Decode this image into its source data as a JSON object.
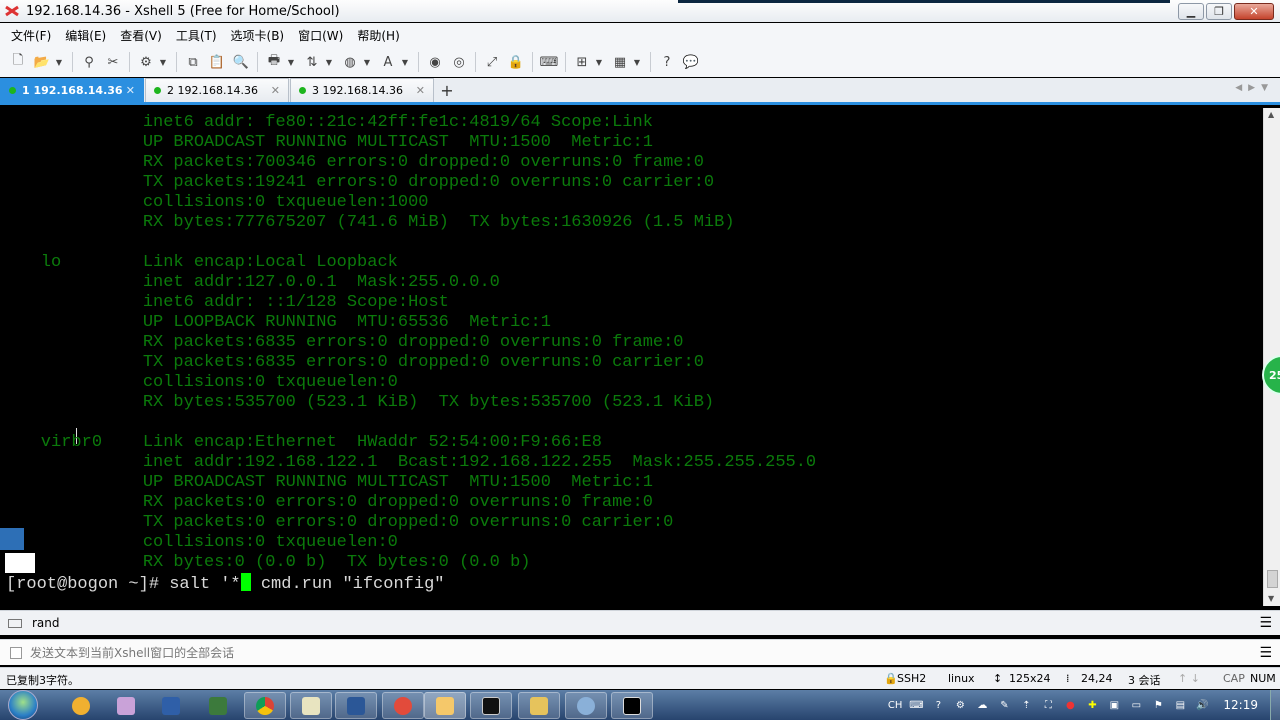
{
  "window": {
    "title": "192.168.14.36 - Xshell 5 (Free for Home/School)",
    "min_label": "▁",
    "max_label": "❐",
    "close_label": "✕"
  },
  "menu": [
    "文件(F)",
    "编辑(E)",
    "查看(V)",
    "工具(T)",
    "选项卡(B)",
    "窗口(W)",
    "帮助(H)"
  ],
  "toolbar_icons": [
    "new-session-icon",
    "open-folder-icon",
    "reconnect-icon",
    "disconnect-icon",
    "properties-icon",
    "copy-icon",
    "paste-icon",
    "find-icon",
    "print-icon",
    "transfer-icon",
    "globe-icon",
    "font-icon",
    "xftp-icon",
    "xmanager-icon",
    "fullscreen-icon",
    "lock-icon",
    "keyboard-icon",
    "add-tab-icon",
    "layout-icon",
    "help-icon",
    "chat-icon"
  ],
  "tabs": [
    {
      "number": "1",
      "label": "192.168.14.36",
      "active": true
    },
    {
      "number": "2",
      "label": "192.168.14.36",
      "active": false
    },
    {
      "number": "3",
      "label": "192.168.14.36",
      "active": false
    }
  ],
  "tab_add_label": "+",
  "terminal": {
    "lines": [
      "              inet6 addr: fe80::21c:42ff:fe1c:4819/64 Scope:Link",
      "              UP BROADCAST RUNNING MULTICAST  MTU:1500  Metric:1",
      "              RX packets:700346 errors:0 dropped:0 overruns:0 frame:0",
      "              TX packets:19241 errors:0 dropped:0 overruns:0 carrier:0",
      "              collisions:0 txqueuelen:1000",
      "              RX bytes:777675207 (741.6 MiB)  TX bytes:1630926 (1.5 MiB)",
      "",
      "    lo        Link encap:Local Loopback",
      "              inet addr:127.0.0.1  Mask:255.0.0.0",
      "              inet6 addr: ::1/128 Scope:Host",
      "              UP LOOPBACK RUNNING  MTU:65536  Metric:1",
      "              RX packets:6835 errors:0 dropped:0 overruns:0 frame:0",
      "              TX packets:6835 errors:0 dropped:0 overruns:0 carrier:0",
      "              collisions:0 txqueuelen:0",
      "              RX bytes:535700 (523.1 KiB)  TX bytes:535700 (523.1 KiB)",
      "",
      "    virbr0    Link encap:Ethernet  HWaddr 52:54:00:F9:66:E8",
      "              inet addr:192.168.122.1  Bcast:192.168.122.255  Mask:255.255.255.0",
      "              UP BROADCAST RUNNING MULTICAST  MTU:1500  Metric:1",
      "              RX packets:0 errors:0 dropped:0 overruns:0 frame:0",
      "              TX packets:0 errors:0 dropped:0 overruns:0 carrier:0",
      "              collisions:0 txqueuelen:0",
      "              RX bytes:0 (0.0 b)  TX bytes:0 (0.0 b)"
    ],
    "prompt": "[root@bogon ~]# salt '*",
    "prompt_after_cursor": " cmd.run \"ifconfig\""
  },
  "badge_value": "25",
  "compose_bar": {
    "text": "rand"
  },
  "send_bar": {
    "placeholder": "发送文本到当前Xshell窗口的全部会话"
  },
  "status": {
    "message": "已复制3字符。",
    "protocol": "SSH2",
    "os": "linux",
    "size": "125x24",
    "cursor_pos": "24,24",
    "sessions": "3 会话",
    "caps": "CAP",
    "num": "NUM"
  },
  "taskbar": {
    "clock": "12:19",
    "ime": "CH"
  },
  "colors": {
    "terminal_text": "#0b7a0b",
    "tab_active": "#2b8fe0",
    "cursor": "#00ff00"
  }
}
